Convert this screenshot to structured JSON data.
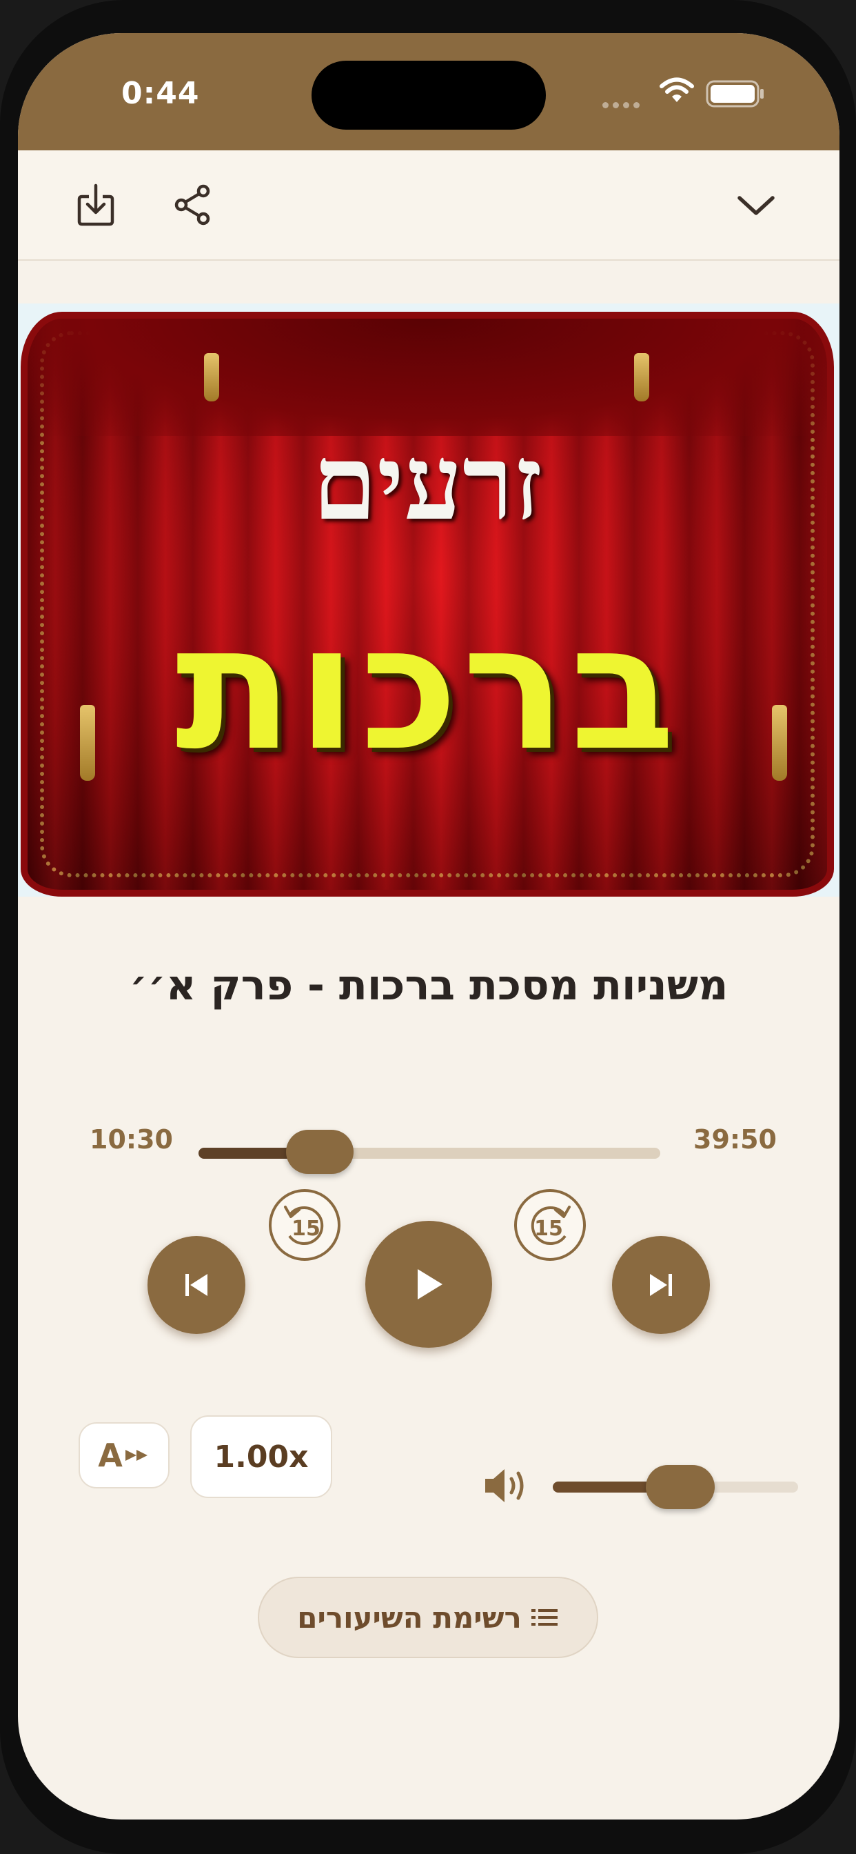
{
  "status": {
    "time": "0:44"
  },
  "toolbar": {
    "download_icon": "download-icon",
    "share_icon": "share-icon",
    "collapse_icon": "chevron-down-icon"
  },
  "artwork": {
    "line1": "זרעים",
    "line2": "ברכות"
  },
  "track": {
    "title": "משניות מסכת ברכות - פרק א׳׳"
  },
  "progress": {
    "elapsed": "10:30",
    "total": "39:50",
    "fraction": 0.262
  },
  "controls": {
    "skip_back_label": "15",
    "skip_forward_label": "15"
  },
  "options": {
    "speed": "1.00x",
    "auto_advance_label": "A"
  },
  "volume": {
    "fraction": 0.52
  },
  "lessons_button": {
    "label": "רשימת השיעורים"
  },
  "colors": {
    "accent": "#8a6a40",
    "background": "#f7f2ea",
    "dark": "#5e4127"
  }
}
